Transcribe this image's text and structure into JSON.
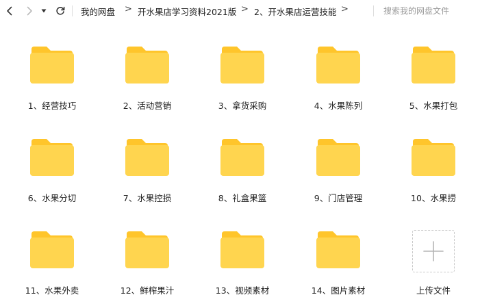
{
  "toolbar": {
    "back_icon": "chevron-left-icon",
    "forward_icon": "chevron-right-icon",
    "history_icon": "caret-down-icon",
    "refresh_icon": "refresh-icon"
  },
  "breadcrumb": {
    "items": [
      "我的网盘",
      "开水果店学习资料2021版",
      "2、开水果店运营技能"
    ],
    "separator": ">"
  },
  "search": {
    "placeholder": "搜索我的网盘文件"
  },
  "folders": [
    "1、经营技巧",
    "2、活动营销",
    "3、拿货采购",
    "4、水果陈列",
    "5、水果打包",
    "6、水果分切",
    "7、水果控损",
    "8、礼盒果篮",
    "9、门店管理",
    "10、水果捞",
    "11、水果外卖",
    "12、鲜榨果汁",
    "13、视频素材",
    "14、图片素材"
  ],
  "upload": {
    "label": "上传文件",
    "icon": "plus-icon"
  },
  "colors": {
    "folder_body": "#FFD54F",
    "folder_back": "#FFC52B",
    "text": "#222222",
    "placeholder": "#9A9A9A"
  }
}
